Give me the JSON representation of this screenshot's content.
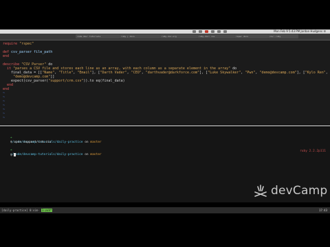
{
  "menubar": {
    "status_text": "Mon Feb 9  5:43 PM    Jordan Hudgens  ☰"
  },
  "tabs": [
    {
      "label": "code.dev: tutorials"
    },
    {
      "label": "ruby | docs"
    },
    {
      "label": "ruby-doc.org"
    },
    {
      "label": "ruby-doc: csv"
    },
    {
      "label": "rspec docs"
    },
    {
      "label": "csv: ruby"
    }
  ],
  "editor": {
    "lines": [
      [
        {
          "t": "require ",
          "c": "kw"
        },
        {
          "t": "\"rspec\"",
          "c": "str"
        }
      ],
      [],
      [
        {
          "t": "def ",
          "c": "kw"
        },
        {
          "t": "csv_parser file_path",
          "c": "fn"
        }
      ],
      [
        {
          "t": "end",
          "c": "kw"
        }
      ],
      [],
      [
        {
          "t": "describe ",
          "c": "kw"
        },
        {
          "t": "\"CSV Parser\"",
          "c": "str"
        },
        {
          "t": " do",
          "c": ""
        }
      ],
      [
        {
          "t": "  it ",
          "c": "kw"
        },
        {
          "t": "\"parses a CSV file and stores each line as an array, with each column as a separate element in the array\"",
          "c": "str"
        },
        {
          "t": " do",
          "c": ""
        }
      ],
      [
        {
          "t": "    final_data = [[",
          "c": ""
        },
        {
          "t": "\"Name\"",
          "c": "str"
        },
        {
          "t": ", ",
          "c": ""
        },
        {
          "t": "\"Title\"",
          "c": "str"
        },
        {
          "t": ", ",
          "c": ""
        },
        {
          "t": "\"Email\"",
          "c": "str"
        },
        {
          "t": "], [",
          "c": ""
        },
        {
          "t": "\"Darth Vader\"",
          "c": "str"
        },
        {
          "t": ", ",
          "c": ""
        },
        {
          "t": "\"CEO\"",
          "c": "str"
        },
        {
          "t": ", ",
          "c": ""
        },
        {
          "t": "\"darthvader@darkforce.com\"",
          "c": "str"
        },
        {
          "t": "], [",
          "c": ""
        },
        {
          "t": "\"Luke Skywalker\"",
          "c": "str"
        },
        {
          "t": ", ",
          "c": ""
        },
        {
          "t": "\"Pwn\"",
          "c": "str"
        },
        {
          "t": ", ",
          "c": ""
        },
        {
          "t": "\"demo@devcamp.com\"",
          "c": "str"
        },
        {
          "t": "], [",
          "c": ""
        },
        {
          "t": "\"Kylo Ren\"",
          "c": "str"
        },
        {
          "t": ", ",
          "c": ""
        },
        {
          "t": "\"CFO\"",
          "c": "str"
        },
        {
          "t": ",",
          "c": ""
        }
      ],
      [
        {
          "t": "     ",
          "c": ""
        },
        {
          "t": "\"demo@devcamp.com\"",
          "c": "str"
        },
        {
          "t": "]]",
          "c": ""
        }
      ],
      [
        {
          "t": "    expect(csv_parser(",
          "c": ""
        },
        {
          "t": "\"support/crm.csv\"",
          "c": "str"
        },
        {
          "t": ")).to eq(final_data)",
          "c": ""
        }
      ],
      [
        {
          "t": "  end",
          "c": "kw"
        }
      ],
      [
        {
          "t": "end",
          "c": "kw"
        }
      ]
    ],
    "tilde": "~",
    "tilde_count": 7
  },
  "terminal": {
    "prompt_symbol": "➜",
    "path": "~/code/devcamp-tutorials/daily-practice",
    "on_text": " on ",
    "branch": "master",
    "command": "open support/crm.csv",
    "ruby_version": "ruby 2.2.2p111"
  },
  "logo": {
    "text": "devCamp"
  },
  "statusbar": {
    "session": "[daily-practice]",
    "window": "0:vim-",
    "window_active": "1:zsh*",
    "time": "17:43"
  }
}
